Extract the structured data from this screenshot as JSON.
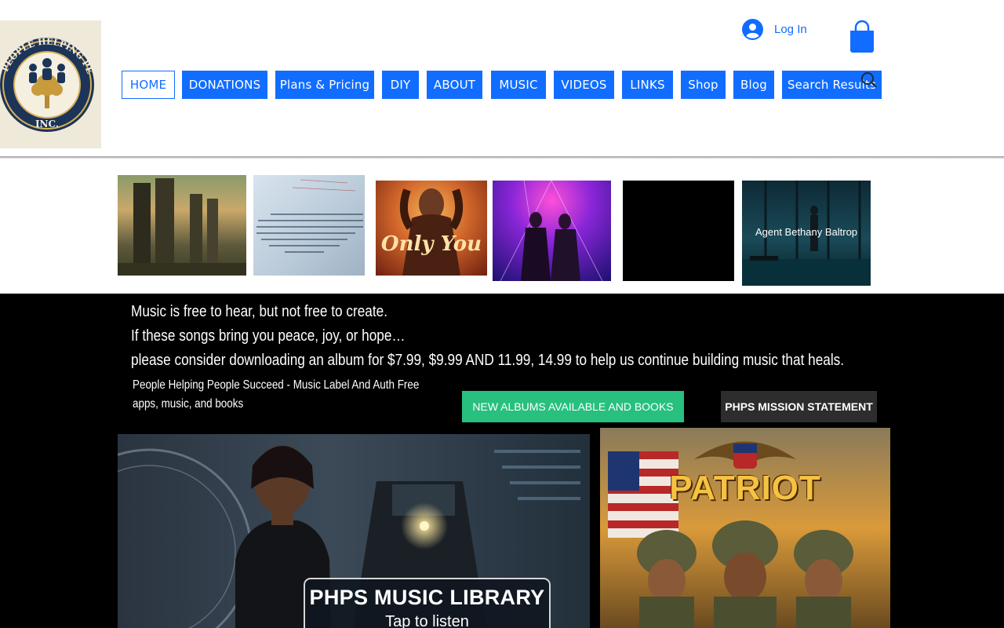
{
  "header": {
    "login_label": "Log In",
    "logo_text_arc": "PEOPLE HELPING PEOPLE",
    "logo_text_bottom": "INC.",
    "nav": [
      {
        "label": "HOME",
        "active": true
      },
      {
        "label": "DONATIONS",
        "active": false
      },
      {
        "label": "Plans & Pricing",
        "active": false
      },
      {
        "label": "DIY",
        "active": false
      },
      {
        "label": "ABOUT",
        "active": false
      },
      {
        "label": "MUSIC",
        "active": false
      },
      {
        "label": "VIDEOS",
        "active": false
      },
      {
        "label": "LINKS",
        "active": false
      },
      {
        "label": "Shop",
        "active": false
      },
      {
        "label": "Blog",
        "active": false
      },
      {
        "label": "Search Results",
        "active": false
      }
    ]
  },
  "gallery": {
    "items": [
      {
        "name": "soldiers-sunrise-photo"
      },
      {
        "name": "handwritten-letter-photo"
      },
      {
        "name": "only-you-album-cover",
        "caption": "Only You"
      },
      {
        "name": "dance-party-photo"
      },
      {
        "name": "black-video-thumbnail"
      },
      {
        "name": "agent-bethany-baltrop-thumbnail",
        "caption": "Agent Bethany Baltrop"
      }
    ]
  },
  "promo": {
    "line1": "Music is free to hear, but not free to create.",
    "line2": "If these songs bring you peace, joy, or hope…",
    "line3": "please consider downloading an album for $7.99, $9.99 AND 11.99, 14.99 to help us continue building music that heals.",
    "tagline": "People Helping People Succeed - Music Label And Auth Free apps, music, and books",
    "albums_button": "NEW ALBUMS AVAILABLE AND BOOKS",
    "mission_button": "PHPS MISSION STATEMENT",
    "library_title": "PHPS MUSIC LIBRARY",
    "library_sub": "Tap to listen",
    "patriot_title": "PATRIOT"
  },
  "colors": {
    "accent_blue": "#116dff",
    "green_button": "#27c07e",
    "dark_button": "#2d2d2d",
    "promo_bg": "#000000"
  }
}
